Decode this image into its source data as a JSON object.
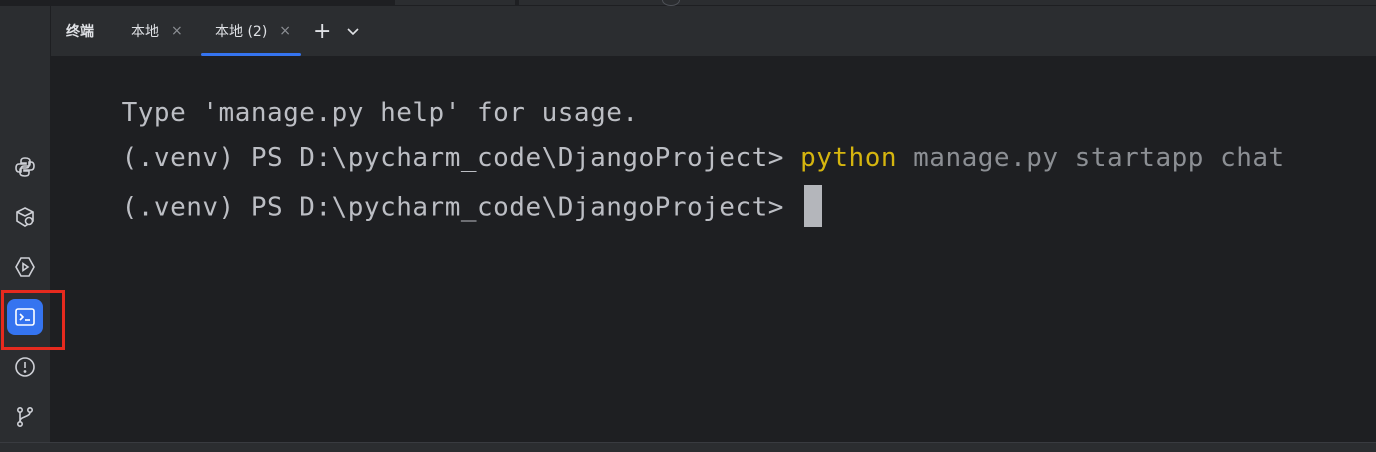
{
  "tabs": {
    "title": "终端",
    "items": [
      {
        "label": "本地",
        "close": "×"
      },
      {
        "label": "本地 (2)",
        "close": "×"
      }
    ],
    "add": "+",
    "dropdown": "⌄"
  },
  "sidebar": {
    "items": [
      {
        "name": "python-console",
        "icon": "python-icon"
      },
      {
        "name": "python-packages",
        "icon": "packages-icon"
      },
      {
        "name": "services",
        "icon": "services-icon"
      },
      {
        "name": "terminal",
        "icon": "terminal-icon",
        "active": true
      },
      {
        "name": "problems",
        "icon": "problems-icon"
      },
      {
        "name": "version-control",
        "icon": "git-icon"
      }
    ]
  },
  "terminal": {
    "line1": "Type 'manage.py help' for usage.",
    "line2_prompt": "(.venv) PS D:\\pycharm_code\\DjangoProject> ",
    "line2_cmd": "python",
    "line2_args": " manage.py startapp chat",
    "line3_prompt": "(.venv) PS D:\\pycharm_code\\DjangoProject> "
  },
  "colors": {
    "accent": "#3574f0",
    "command": "#d5b50f",
    "highlight_box": "#e62a1e"
  }
}
